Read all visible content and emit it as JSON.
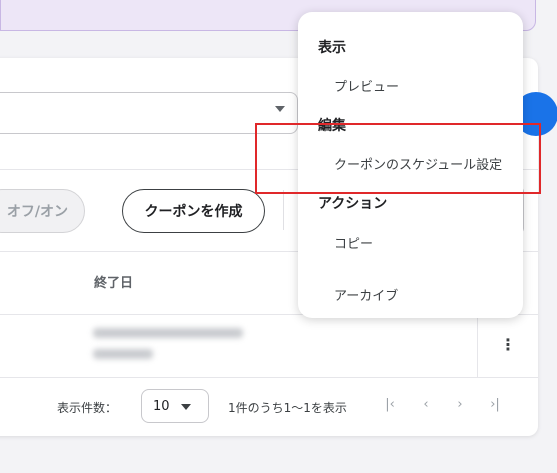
{
  "toolbar": {
    "toggle_label": "オフ/オン",
    "create_label": "クーポンを作成"
  },
  "table": {
    "columns": [
      "終了日"
    ]
  },
  "pagination": {
    "rows_label": "表示件数：",
    "rows_value": "10",
    "info": "1件のうち1～1を表示",
    "nav": {
      "first": "|‹",
      "prev": "‹",
      "next": "›",
      "last": "›|"
    }
  },
  "menu": {
    "sections": [
      {
        "title": "表示",
        "items": [
          "プレビュー"
        ]
      },
      {
        "title": "編集",
        "items": [
          "クーポンのスケジュール設定"
        ]
      },
      {
        "title": "アクション",
        "items": [
          "コピー",
          "アーカイブ"
        ]
      }
    ]
  },
  "colors": {
    "accent": "#1a73e8",
    "highlight": "#e0282a",
    "banner": "#ede6f7"
  }
}
